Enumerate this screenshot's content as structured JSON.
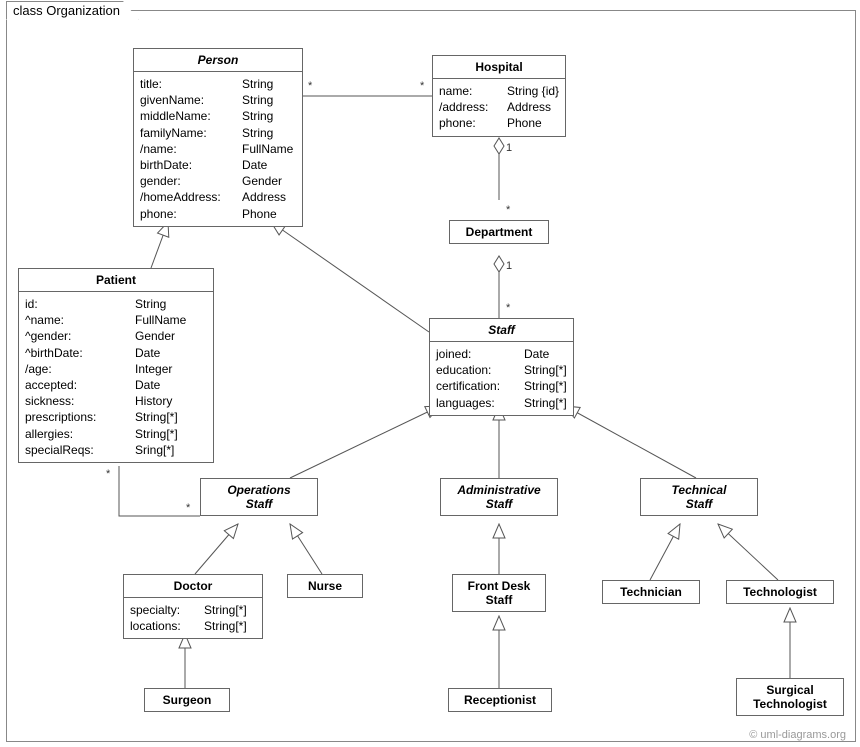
{
  "frame_title": "class Organization",
  "credit": "© uml-diagrams.org",
  "classes": {
    "person": {
      "name": "Person",
      "attrs": [
        [
          "title:",
          "String"
        ],
        [
          "givenName:",
          "String"
        ],
        [
          "middleName:",
          "String"
        ],
        [
          "familyName:",
          "String"
        ],
        [
          "/name:",
          "FullName"
        ],
        [
          "birthDate:",
          "Date"
        ],
        [
          "gender:",
          "Gender"
        ],
        [
          "/homeAddress:",
          "Address"
        ],
        [
          "phone:",
          "Phone"
        ]
      ]
    },
    "hospital": {
      "name": "Hospital",
      "attrs": [
        [
          "name:",
          "String {id}"
        ],
        [
          "/address:",
          "Address"
        ],
        [
          "phone:",
          "Phone"
        ]
      ]
    },
    "department": {
      "name": "Department"
    },
    "patient": {
      "name": "Patient",
      "attrs": [
        [
          "id:",
          "String"
        ],
        [
          "^name:",
          "FullName"
        ],
        [
          "^gender:",
          "Gender"
        ],
        [
          "^birthDate:",
          "Date"
        ],
        [
          "/age:",
          "Integer"
        ],
        [
          "accepted:",
          "Date"
        ],
        [
          "sickness:",
          "History"
        ],
        [
          "prescriptions:",
          "String[*]"
        ],
        [
          "allergies:",
          "String[*]"
        ],
        [
          "specialReqs:",
          "Sring[*]"
        ]
      ]
    },
    "staff": {
      "name": "Staff",
      "attrs": [
        [
          "joined:",
          "Date"
        ],
        [
          "education:",
          "String[*]"
        ],
        [
          "certification:",
          "String[*]"
        ],
        [
          "languages:",
          "String[*]"
        ]
      ]
    },
    "ops_staff": {
      "name": "Operations\nStaff"
    },
    "admin_staff": {
      "name": "Administrative\nStaff"
    },
    "tech_staff": {
      "name": "Technical\nStaff"
    },
    "doctor": {
      "name": "Doctor",
      "attrs": [
        [
          "specialty:",
          "String[*]"
        ],
        [
          "locations:",
          "String[*]"
        ]
      ]
    },
    "nurse": {
      "name": "Nurse"
    },
    "frontdesk": {
      "name": "Front Desk\nStaff"
    },
    "technician": {
      "name": "Technician"
    },
    "technologist": {
      "name": "Technologist"
    },
    "surgeon": {
      "name": "Surgeon"
    },
    "receptionist": {
      "name": "Receptionist"
    },
    "surg_tech": {
      "name": "Surgical\nTechnologist"
    }
  },
  "mults": {
    "person_hosp_left": "*",
    "person_hosp_right": "*",
    "hosp_dept_1": "1",
    "hosp_dept_star": "*",
    "dept_staff_1": "1",
    "dept_staff_star": "*",
    "pat_ops_left": "*",
    "pat_ops_right": "*"
  }
}
